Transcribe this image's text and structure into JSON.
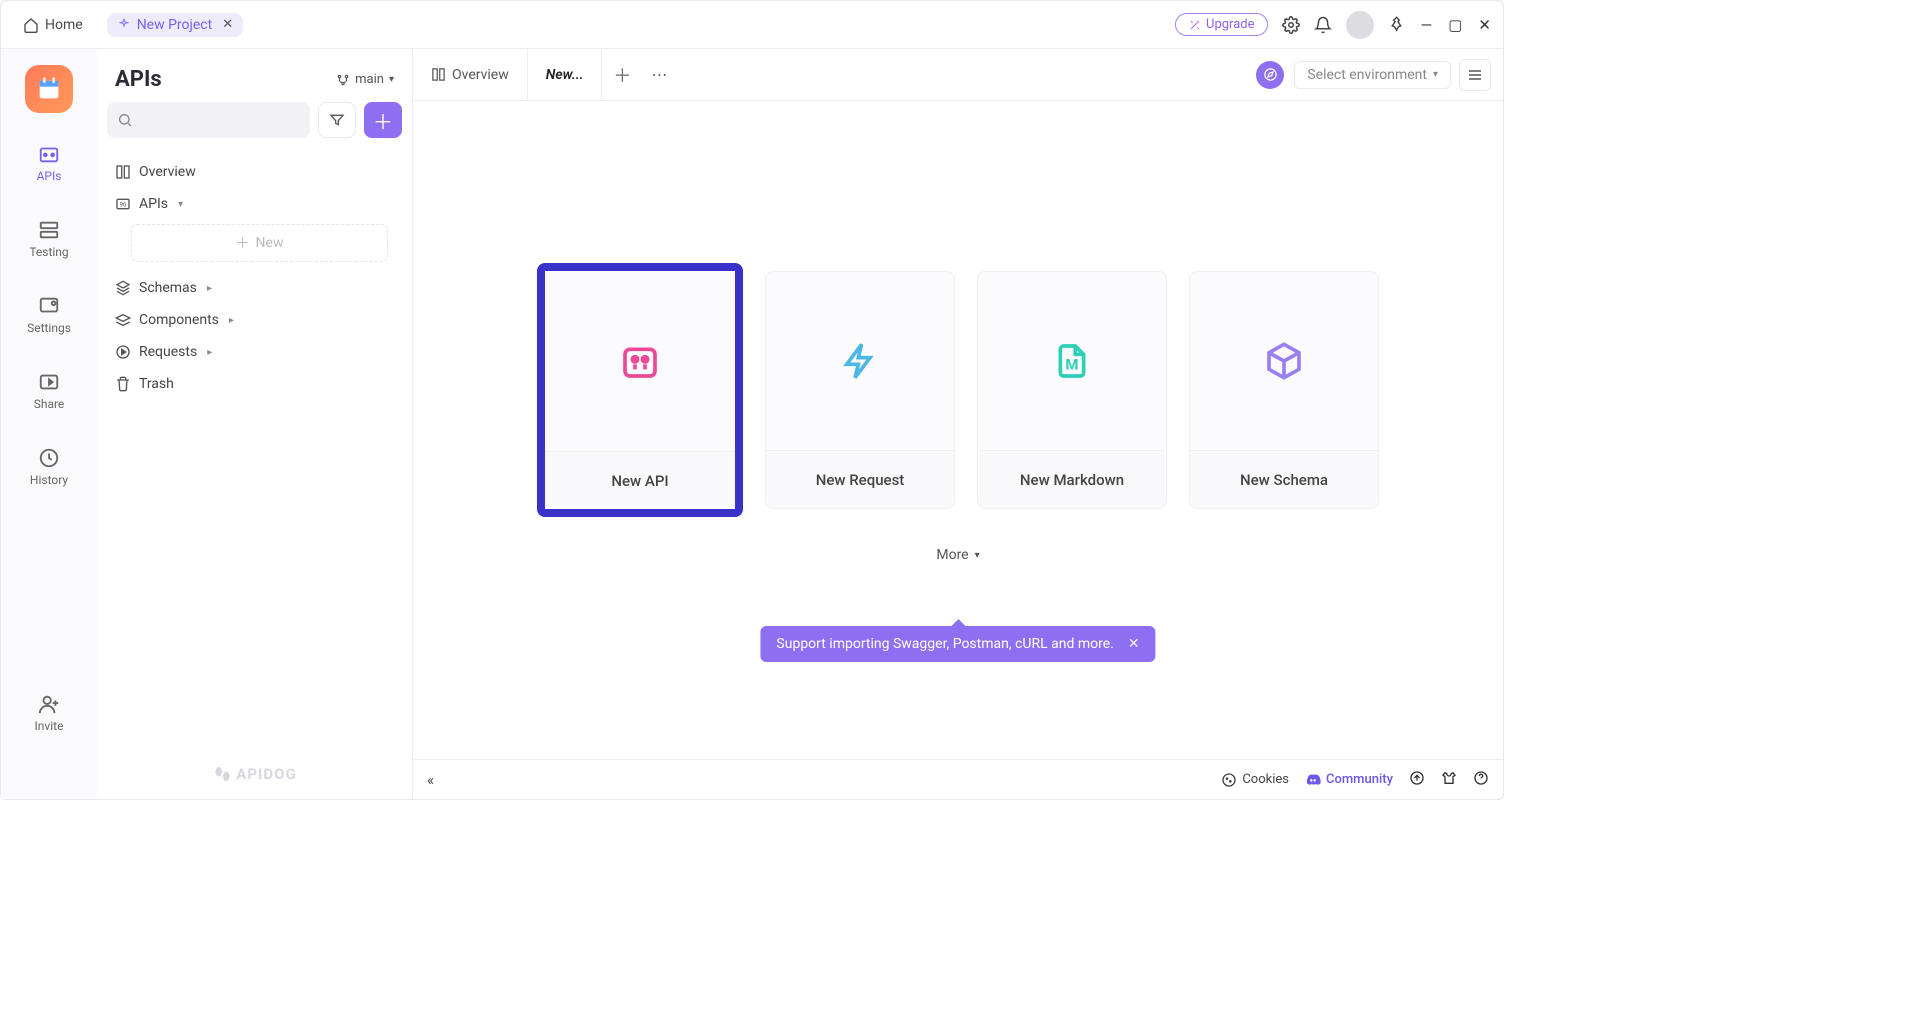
{
  "titlebar": {
    "home": "Home",
    "project_tab": "New Project",
    "upgrade": "Upgrade"
  },
  "rail": {
    "items": [
      {
        "label": "APIs",
        "active": true
      },
      {
        "label": "Testing"
      },
      {
        "label": "Settings"
      },
      {
        "label": "Share"
      },
      {
        "label": "History"
      }
    ],
    "invite": "Invite"
  },
  "sidebar": {
    "title": "APIs",
    "branch": "main",
    "tree": {
      "overview": "Overview",
      "apis": "APIs",
      "schemas": "Schemas",
      "components": "Components",
      "requests": "Requests",
      "trash": "Trash",
      "new_placeholder": "New"
    },
    "brand": "APIDOG"
  },
  "tabs": {
    "overview": "Overview",
    "new": "New...",
    "env_placeholder": "Select environment"
  },
  "cards": [
    {
      "label": "New API"
    },
    {
      "label": "New Request"
    },
    {
      "label": "New Markdown"
    },
    {
      "label": "New Schema"
    }
  ],
  "more": "More",
  "tooltip": "Support importing Swagger, Postman, cURL and more.",
  "footer": {
    "cookies": "Cookies",
    "community": "Community"
  }
}
